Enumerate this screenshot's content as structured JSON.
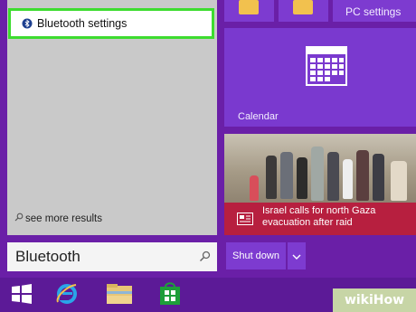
{
  "search_results": {
    "top_result": {
      "label": "Bluetooth settings",
      "icon": "bluetooth-icon"
    },
    "see_more": {
      "label": "see more results",
      "icon": "search-icon"
    }
  },
  "search_box": {
    "value": "Bluetooth",
    "icon": "search-icon"
  },
  "tiles": {
    "pc_settings": {
      "label": "PC settings"
    },
    "calendar": {
      "label": "Calendar",
      "icon": "calendar-icon"
    },
    "news": {
      "headline": "Israel calls for north Gaza evacuation after raid",
      "icon": "news-icon"
    }
  },
  "power": {
    "shutdown_label": "Shut down",
    "menu_icon": "chevron-down-icon"
  },
  "taskbar": {
    "items": [
      {
        "name": "start-button",
        "icon": "windows-logo-icon"
      },
      {
        "name": "internet-explorer",
        "icon": "internet-explorer-icon"
      },
      {
        "name": "file-explorer",
        "icon": "folder-icon"
      },
      {
        "name": "store",
        "icon": "store-icon"
      }
    ]
  },
  "watermark": {
    "text": "wikiHow"
  },
  "colors": {
    "background": "#6a1fa7",
    "highlight_border": "#3ddc2f",
    "tile": "#7d3bd0",
    "news_bar": "#b71f3f"
  }
}
